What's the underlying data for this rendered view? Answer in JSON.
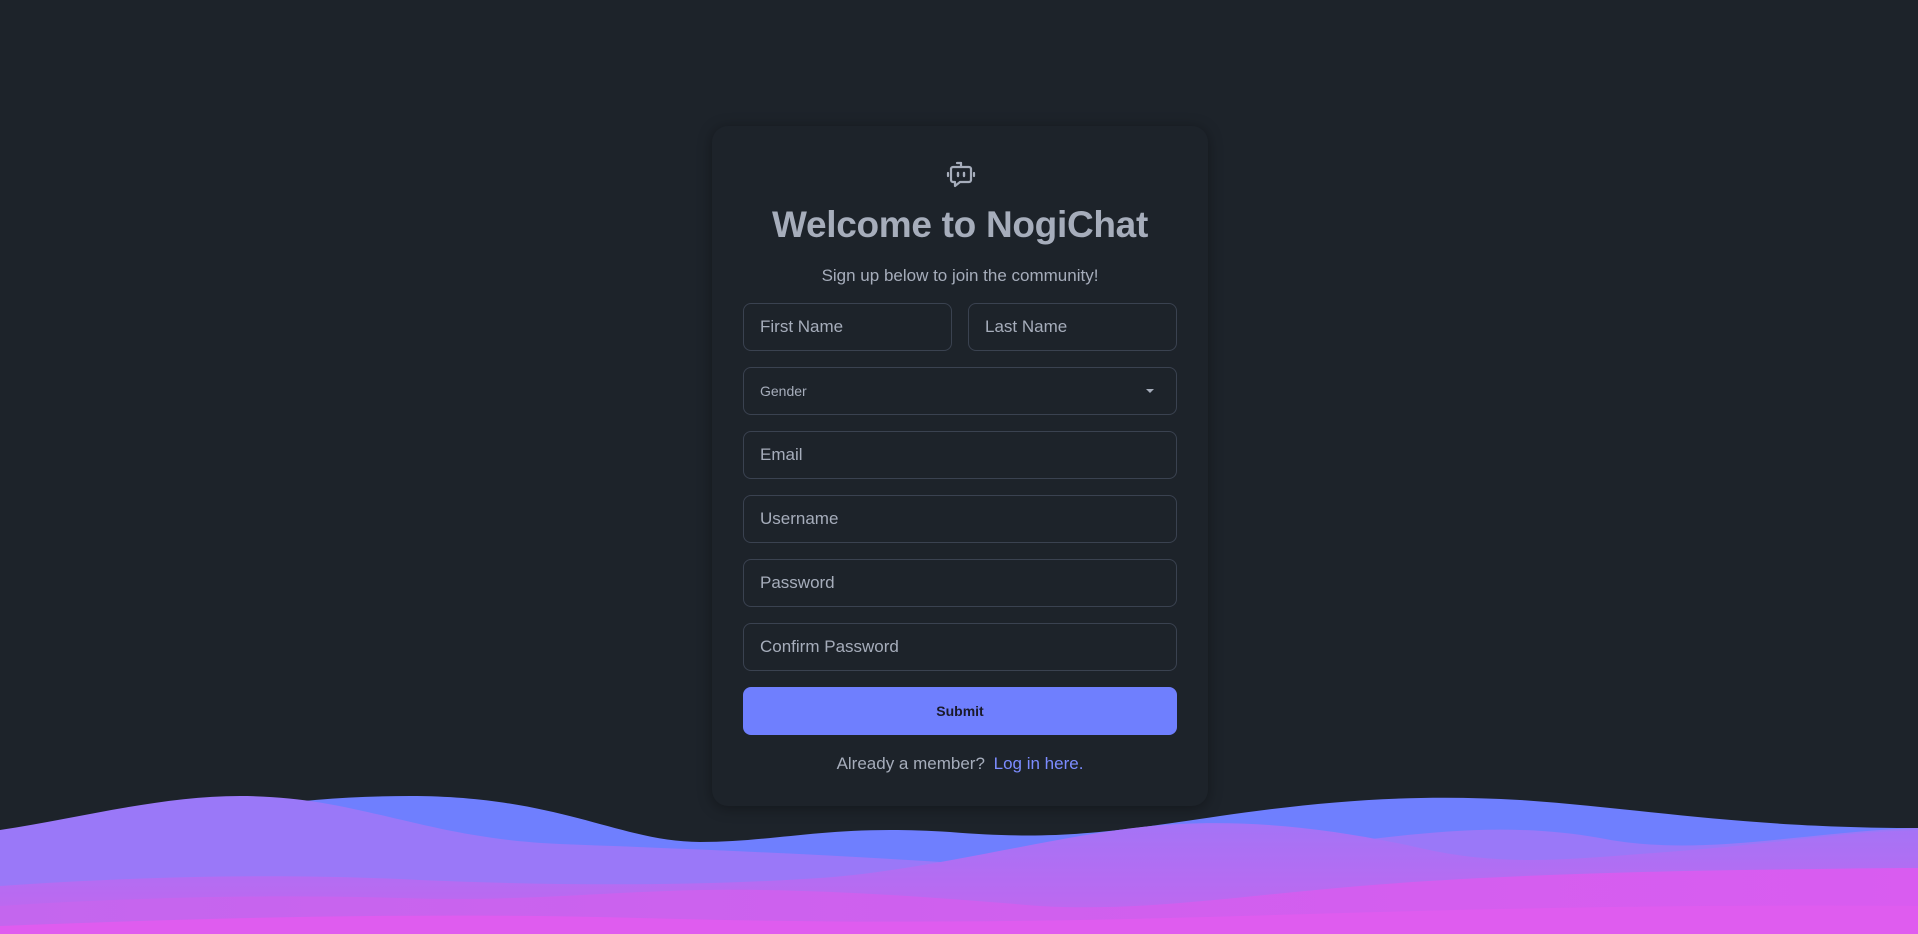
{
  "header": {
    "title": "Welcome to NogiChat",
    "subtitle": "Sign up below to join the community!",
    "icon": "bot-icon"
  },
  "form": {
    "first_name": {
      "value": "",
      "placeholder": "First Name"
    },
    "last_name": {
      "value": "",
      "placeholder": "Last Name"
    },
    "gender": {
      "selected": "Gender"
    },
    "email": {
      "value": "",
      "placeholder": "Email"
    },
    "username": {
      "value": "",
      "placeholder": "Username"
    },
    "password": {
      "value": "",
      "placeholder": "Password"
    },
    "confirm_password": {
      "value": "",
      "placeholder": "Confirm Password"
    },
    "submit_label": "Submit"
  },
  "footer": {
    "prompt": "Already a member?",
    "link_label": "Log in here."
  },
  "colors": {
    "background": "#1d232a",
    "text": "#a6adbb",
    "primary": "#6f7ffe",
    "link": "#7c8cff",
    "wave_purple": "#9a78f8",
    "wave_pink": "#d55ef0"
  }
}
